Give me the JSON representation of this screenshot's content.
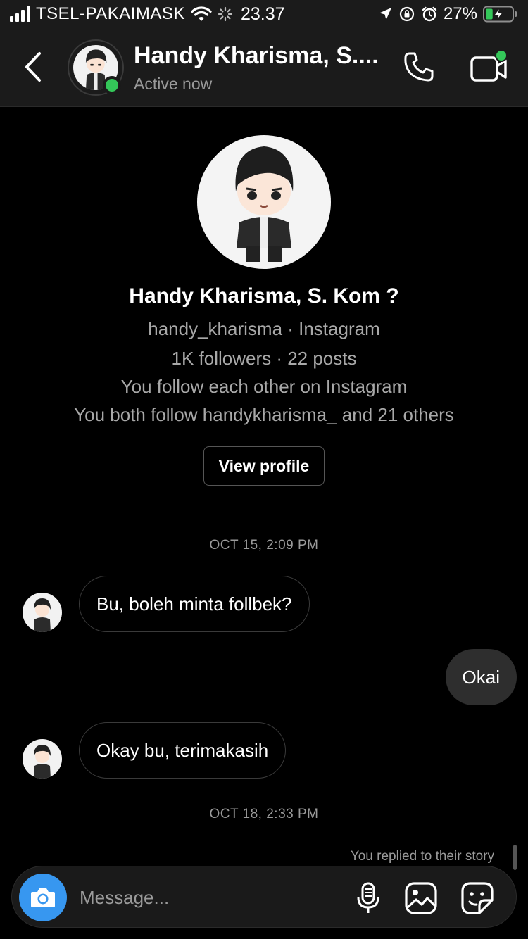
{
  "status_bar": {
    "carrier": "TSEL-PAKAIMASK",
    "time": "23.37",
    "battery_percent": "27%",
    "signal_bars": 4,
    "battery_level": 0.27,
    "charging": true,
    "icons": [
      "signal-icon",
      "wifi-icon",
      "activity-spinner-icon",
      "location-arrow-icon",
      "orientation-lock-icon",
      "alarm-icon",
      "battery-icon"
    ]
  },
  "header": {
    "name": "Handy Kharisma, S....",
    "status": "Active now",
    "icons": [
      "back-chevron-icon",
      "phone-icon",
      "video-camera-icon"
    ],
    "online_color": "#34c759"
  },
  "profile": {
    "name": "Handy Kharisma, S. Kom ?",
    "username_line": "handy_kharisma · Instagram",
    "stats_line": "1K followers · 22 posts",
    "mutual_follow": "You follow each other on Instagram",
    "mutual_followers": "You both follow handykharisma_ and 21 others",
    "view_profile_label": "View profile"
  },
  "conversation": {
    "timestamp_1": "OCT 15, 2:09 PM",
    "messages": [
      {
        "from": "them",
        "text": "Bu, boleh minta follbek?"
      },
      {
        "from": "me",
        "text": "Okai"
      },
      {
        "from": "them",
        "text": "Okay bu, terimakasih"
      }
    ],
    "timestamp_2": "OCT 18, 2:33 PM",
    "reply_note": "You replied to their story"
  },
  "composer": {
    "placeholder": "Message...",
    "icons": [
      "camera-icon",
      "microphone-icon",
      "gallery-icon",
      "sticker-icon"
    ],
    "camera_color": "#3797f0"
  }
}
